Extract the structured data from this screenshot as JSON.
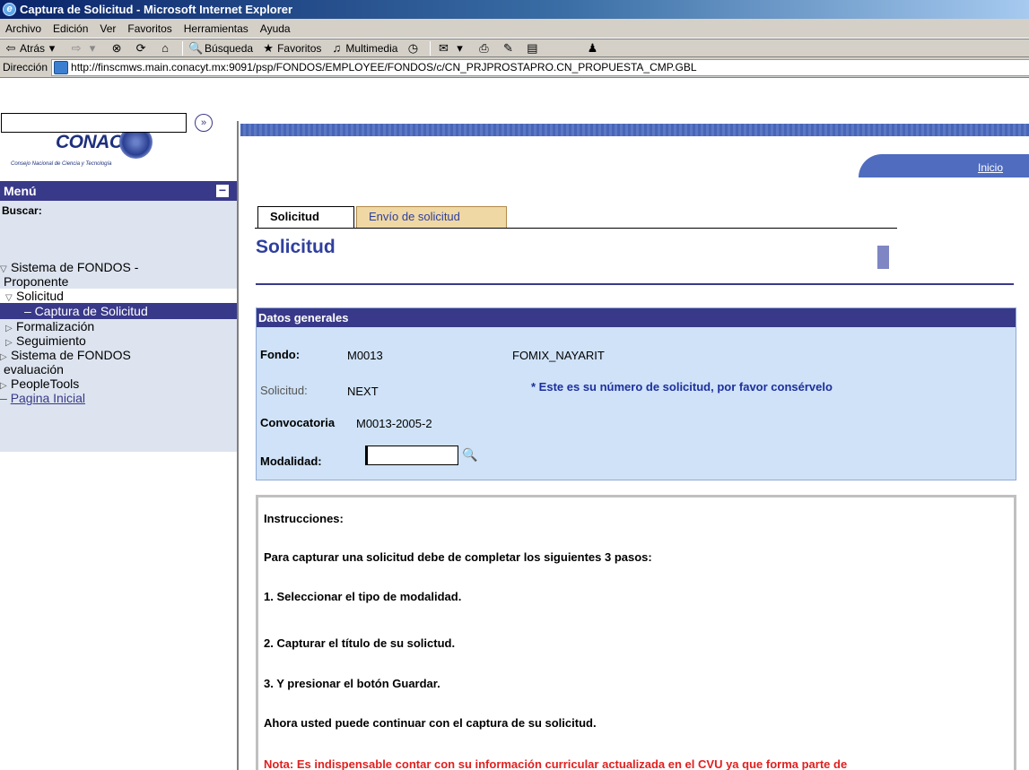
{
  "window": {
    "title": "Captura de Solicitud - Microsoft Internet Explorer"
  },
  "menubar": {
    "items": [
      "Archivo",
      "Edición",
      "Ver",
      "Favoritos",
      "Herramientas",
      "Ayuda"
    ]
  },
  "toolbar": {
    "back_label": "Atrás",
    "search_label": "Búsqueda",
    "favorites_label": "Favoritos",
    "media_label": "Multimedia"
  },
  "address": {
    "label": "Dirección",
    "url": "http://finscmws.main.conacyt.mx:9091/psp/FONDOS/EMPLOYEE/FONDOS/c/CN_PRJPROSTAPRO.CN_PROPUESTA_CMP.GBL"
  },
  "brand": {
    "name": "CONACYT",
    "subtitle": "Consejo Nacional de Ciencia y Tecnología"
  },
  "banner": {
    "home_link": "Inicio"
  },
  "sidebar": {
    "title": "Menú",
    "search_label": "Buscar:",
    "tree": [
      {
        "label": "Sistema de FONDOS -"
      },
      {
        "label": "Proponente"
      },
      {
        "label": "Solicitud"
      },
      {
        "label": "– Captura de Solicitud"
      },
      {
        "label": "Formalización"
      },
      {
        "label": "Seguimiento"
      },
      {
        "label": "Sistema de FONDOS"
      },
      {
        "label": "evaluación"
      },
      {
        "label": "PeopleTools"
      },
      {
        "label": "Pagina Inicial"
      }
    ]
  },
  "tabs": [
    {
      "label": "Solicitud"
    },
    {
      "label": "Envío de solicitud"
    }
  ],
  "page": {
    "title": "Solicitud"
  },
  "datos": {
    "heading": "Datos generales",
    "fondo_label": "Fondo:",
    "fondo_code": "M0013",
    "fondo_name": "FOMIX_NAYARIT",
    "solicitud_label": "Solicitud:",
    "solicitud_value": "NEXT",
    "solicitud_note": "* Este es su número de solicitud, por favor consérvelo",
    "convocatoria_label": "Convocatoria",
    "convocatoria_value": "M0013-2005-2",
    "modalidad_label": "Modalidad:",
    "modalidad_value": ""
  },
  "instrucciones": {
    "title": "Instrucciones:",
    "intro": "Para capturar una solicitud debe de completar los siguientes 3 pasos:",
    "step1": "1. Seleccionar el tipo de modalidad.",
    "step2": "2. Capturar el título de su solictud.",
    "step3": "3. Y presionar el botón Guardar.",
    "continue": "Ahora usted puede continuar con el captura de su solicitud.",
    "note": "Nota: Es indispensable contar con su información curricular actualizada en el CVU ya que forma parte de"
  }
}
